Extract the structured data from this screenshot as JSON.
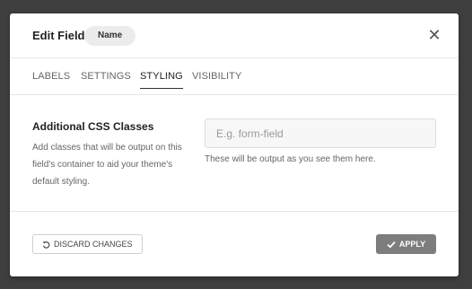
{
  "header": {
    "title": "Edit Field",
    "field_badge": "Name",
    "close_glyph": "✕"
  },
  "tabs": [
    {
      "label": "LABELS",
      "active": false
    },
    {
      "label": "SETTINGS",
      "active": false
    },
    {
      "label": "STYLING",
      "active": true
    },
    {
      "label": "VISIBILITY",
      "active": false
    }
  ],
  "styling": {
    "css_classes_label": "Additional CSS Classes",
    "css_classes_description": "Add classes that will be output on this field's container to aid your theme's default styling.",
    "css_classes_value": "",
    "css_classes_placeholder": "E.g. form-field",
    "css_classes_hint": "These will be output as you see them here."
  },
  "footer": {
    "discard_label": "DISCARD CHANGES",
    "apply_label": "APPLY"
  },
  "icons": {
    "close": "close-icon",
    "discard": "undo-icon",
    "apply": "check-icon"
  },
  "colors": {
    "backdrop": "#3f3f3f",
    "apply_button": "#7d7d7d",
    "active_tab_underline": "#333333"
  }
}
